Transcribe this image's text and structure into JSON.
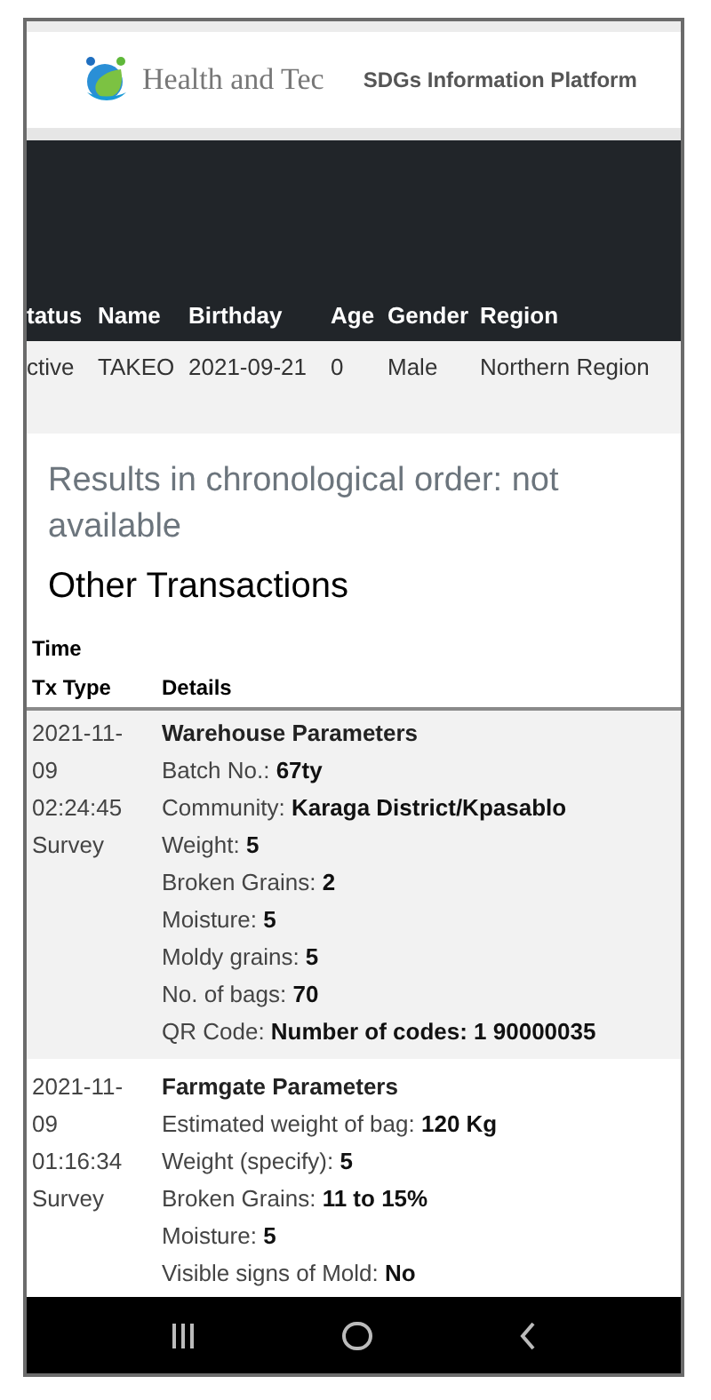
{
  "header": {
    "logo_text": "Health and Tec",
    "platform": "SDGs Information Platform"
  },
  "profile_table": {
    "columns": [
      "tatus",
      "Name",
      "Birthday",
      "Age",
      "Gender",
      "Region"
    ],
    "rows": [
      [
        "ctive",
        "TAKEO",
        "2021-09-21",
        "0",
        "Male",
        "Northern Region"
      ]
    ]
  },
  "results_notice": "Results in chronological order: not available",
  "section_title": "Other Transactions",
  "transactions": {
    "columns": [
      [
        "Time",
        "Tx Type"
      ],
      [
        "Details"
      ]
    ],
    "rows": [
      {
        "time_lines": [
          "2021-11-",
          "09",
          "02:24:45"
        ],
        "type": "Survey",
        "title": "Warehouse Parameters",
        "fields": [
          {
            "label": "Batch No.:",
            "value": "67ty"
          },
          {
            "label": "Community:",
            "value": "Karaga District/Kpasablo"
          },
          {
            "label": "Weight:",
            "value": "5"
          },
          {
            "label": "Broken Grains:",
            "value": "2"
          },
          {
            "label": "Moisture:",
            "value": "5"
          },
          {
            "label": "Moldy grains:",
            "value": "5"
          },
          {
            "label": "No. of bags:",
            "value": "70"
          },
          {
            "label": "QR Code:",
            "value": "Number of codes: 1 90000035"
          }
        ]
      },
      {
        "time_lines": [
          "2021-11-",
          "09",
          "01:16:34"
        ],
        "type": "Survey",
        "title": "Farmgate Parameters",
        "fields": [
          {
            "label": "Estimated weight of bag:",
            "value": "120 Kg"
          },
          {
            "label": "Weight (specify):",
            "value": "5"
          },
          {
            "label": "Broken Grains:",
            "value": "11 to 15%"
          },
          {
            "label": "Moisture:",
            "value": "5"
          },
          {
            "label": "Visible signs of Mold:",
            "value": "No"
          }
        ]
      }
    ]
  }
}
